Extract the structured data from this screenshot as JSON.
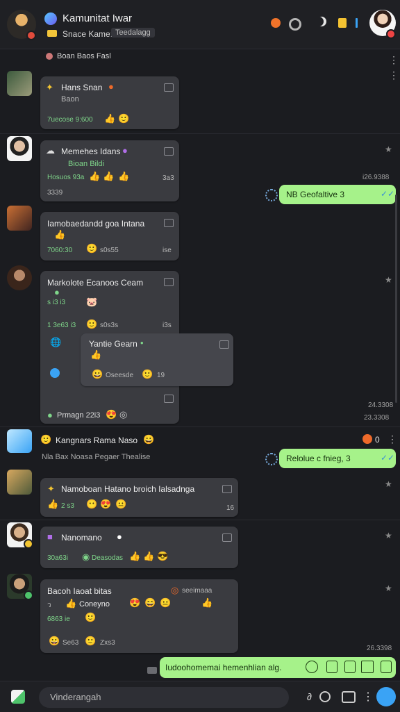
{
  "header": {
    "title": "Kamunitat Iwar",
    "subtitle_label": "Snace Kame:",
    "subtitle_tag": "Teedalagg"
  },
  "feed": {
    "top_label": "Boan Baos Fasl",
    "messages": [
      {
        "name": "Hans Snan",
        "line2": "Baon",
        "meta": "7uecose 9:600"
      },
      {
        "name": "Memehes Idans",
        "line2": "Bioan Bildi",
        "meta": "Hosuos 93a",
        "count": "3a3",
        "extra": "3339"
      },
      {
        "name": "Iamobaedandd goa Intana",
        "meta": "7060:30",
        "meta2": "s0s55",
        "count": "ise"
      },
      {
        "name": "Markolote Ecanoos Ceam",
        "line2": "s i3 i3",
        "meta": "1 3e63 i3",
        "meta2": "s0s3s",
        "count": "i3s",
        "reply": {
          "name": "Yantie Gearn",
          "meta": "Oseesde",
          "count": "19"
        },
        "footer": "Prmagn 22i3"
      },
      {
        "name": "Kangnars Rama Naso",
        "sub": "Nla Bax Noasa Pegaer Thealise",
        "count": "0"
      },
      {
        "name": "Namoboan Hatano broich Ialsadnga",
        "meta": "2 s3",
        "count": "16"
      },
      {
        "name": "Nanomano",
        "meta": "30a63i",
        "meta2": "Deasodas"
      },
      {
        "name": "Bacoh Iaoat bitas",
        "tag": "seeimaaa",
        "line2": "Coneyno",
        "meta": "6863 ie",
        "meta2": "Se63",
        "extra": "Zxs3"
      }
    ],
    "outgoing": [
      {
        "text": "NB Geofaltive 3",
        "time": "i26.9388"
      },
      {
        "text": "Relolue c fnieg, 3",
        "time": "24.3308"
      },
      {
        "text": "Iudoohomemai hemenhlian alg.",
        "time": "26.3398"
      }
    ],
    "timestamps": [
      "24.3308",
      "23.3308"
    ]
  },
  "composer": {
    "placeholder": "Vinderangah"
  },
  "colors": {
    "background": "#1b1c20",
    "bubble": "#3a3b40",
    "outgoing": "#a6f28a",
    "accent_blue": "#3aa3f5",
    "meta_green": "#7fd68a"
  },
  "icons": [
    "fire-icon",
    "settings-icon",
    "moon-icon",
    "notes-icon",
    "more-icon",
    "star-icon",
    "reply-icon",
    "emoji-icon",
    "attach-icon",
    "camera-icon",
    "send-icon"
  ]
}
